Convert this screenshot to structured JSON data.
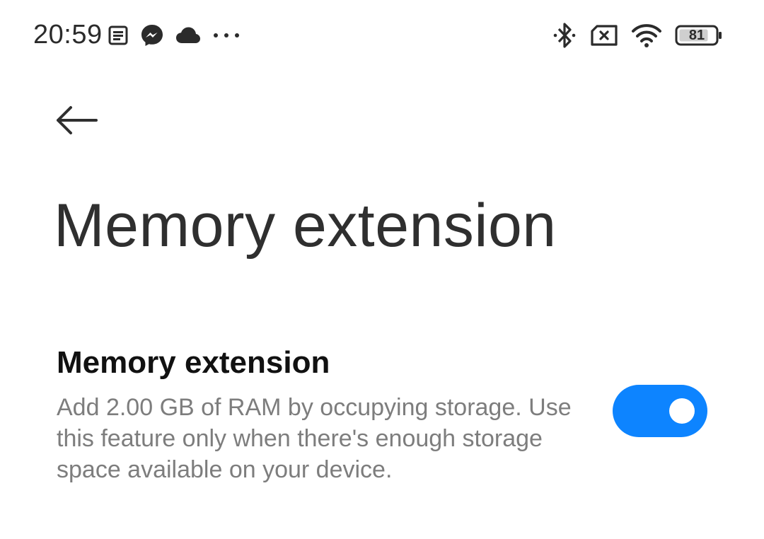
{
  "status_bar": {
    "time": "20:59",
    "battery_level": "81",
    "left_icons": [
      "notes-icon",
      "messenger-icon",
      "cloud-icon",
      "more-notifications-icon"
    ],
    "right_icons": [
      "bluetooth-icon",
      "no-sim-icon",
      "wifi-icon",
      "battery-icon"
    ]
  },
  "header": {
    "title": "Memory extension"
  },
  "setting": {
    "title": "Memory extension",
    "description": "Add 2.00 GB of RAM by occupying storage. Use this feature only when there's enough storage space available on your device.",
    "enabled": true
  },
  "colors": {
    "accent": "#0d84ff",
    "title_text": "#2f2f2f",
    "secondary_text": "#7d7d7d"
  }
}
